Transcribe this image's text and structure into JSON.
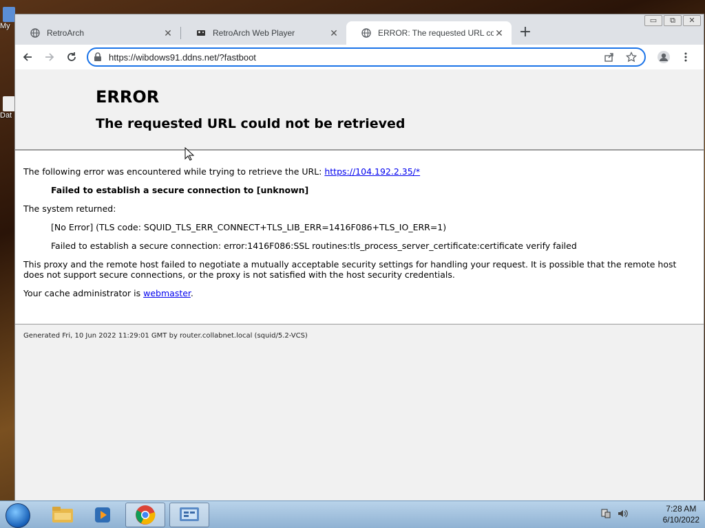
{
  "desktop": {
    "icons": [
      {
        "label": "My"
      },
      {
        "label": "Dat"
      }
    ]
  },
  "window": {
    "controls": {
      "minimize": "▭",
      "restore": "⧉",
      "close": "✕"
    }
  },
  "tabs": [
    {
      "label": "RetroArch",
      "icon": "globe-icon",
      "active": false
    },
    {
      "label": "RetroArch Web Player",
      "icon": "gamepad-icon",
      "active": false
    },
    {
      "label": "ERROR: The requested URL could",
      "icon": "globe-icon",
      "active": true
    }
  ],
  "newtab_label": "+",
  "toolbar": {
    "url": "https://wibdows91.ddns.net/?fastboot"
  },
  "page": {
    "title": "ERROR",
    "subtitle": "The requested URL could not be retrieved",
    "line1_prefix": "The following error was encountered while trying to retrieve the URL:",
    "line1_link": "https://104.192.2.35/*",
    "error_strong": "Failed to establish a secure connection to [unknown]",
    "system_returned": "The system returned:",
    "tls_code": "[No Error] (TLS code: SQUID_TLS_ERR_CONNECT+TLS_LIB_ERR=1416F086+TLS_IO_ERR=1)",
    "secure_fail": "Failed to establish a secure connection: error:1416F086:SSL routines:tls_process_server_certificate:certificate verify failed",
    "proxy_msg": "This proxy and the remote host failed to negotiate a mutually acceptable security settings for handling your request. It is possible that the remote host does not support secure connections, or the proxy is not satisfied with the host security credentials.",
    "cache_admin_prefix": "Your cache administrator is",
    "cache_admin_link": "webmaster",
    "cache_admin_suffix": ".",
    "footer": "Generated Fri, 10 Jun 2022 11:29:01 GMT by router.collabnet.local (squid/5.2-VCS)"
  },
  "taskbar": {
    "apps": [
      "explorer-icon",
      "media-player-icon",
      "chrome-icon",
      "control-panel-icon"
    ],
    "time": "7:28 AM",
    "date": "6/10/2022"
  }
}
